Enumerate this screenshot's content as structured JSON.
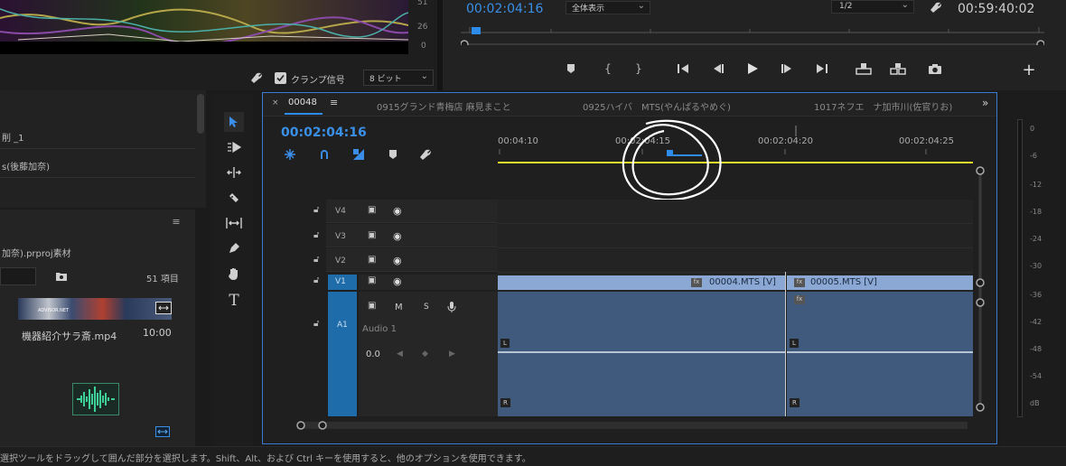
{
  "source_monitor": {
    "scale_labels": [
      "51",
      "26",
      "0"
    ],
    "clamp_label": "クランプ信号",
    "clamp_checked": true,
    "bit_depth": "8 ビット"
  },
  "program_monitor": {
    "timecode": "00:02:04:16",
    "fit": "全体表示",
    "resolution": "1/2",
    "duration": "00:59:40:02"
  },
  "project": {
    "row1": "削 _1",
    "row2": "s(後藤加奈)",
    "project_name": "加奈).prproj素材",
    "item_count": "51 項目",
    "clip_name": "機器紹介サラ斎.mp4",
    "clip_duration": "10:00",
    "thumb_text": "ADVISOR.NET"
  },
  "timeline": {
    "sequence_name": "00048",
    "tab2": "0915グランド青梅店 麻見まこと",
    "tab3": "0925ハイバ　MTS(やんぱるやめぐ)",
    "tab4": "1017ネフエ　ナ加市川(佐官りお)",
    "timecode": "00:02:04:16",
    "ruler": [
      "00:04:10",
      "00:02:04:15",
      "00:02:04:20",
      "00:02:04:25"
    ],
    "tracks": {
      "v4": "V4",
      "v3": "V3",
      "v2": "V2",
      "v1_src": "V1",
      "v1": "V1",
      "a1_src": "A1",
      "a1": "A1",
      "audio_name": "Audio 1",
      "mute": "M",
      "solo": "S",
      "volume": "0.0"
    },
    "clips": {
      "clip1": "00004.MTS [V]",
      "clip2": "00005.MTS [V]",
      "marker_l": "L",
      "marker_r": "R"
    }
  },
  "audio_meter": {
    "scale": [
      "0",
      "-6",
      "-12",
      "-18",
      "-24",
      "-30",
      "-36",
      "-42",
      "-48",
      "-54",
      "dB"
    ]
  },
  "status_bar": {
    "text": "選択ツールをドラッグして囲んだ部分を選択します。Shift、Alt、および Ctrl キーを使用すると、他のオプションを使用できます。"
  },
  "colors": {
    "accent": "#2d8ceb",
    "clip_video": "#8aa8d3",
    "clip_audio": "#3f5a7c",
    "playhead_line": "#e3e22a",
    "source_track": "#1f6cab"
  }
}
